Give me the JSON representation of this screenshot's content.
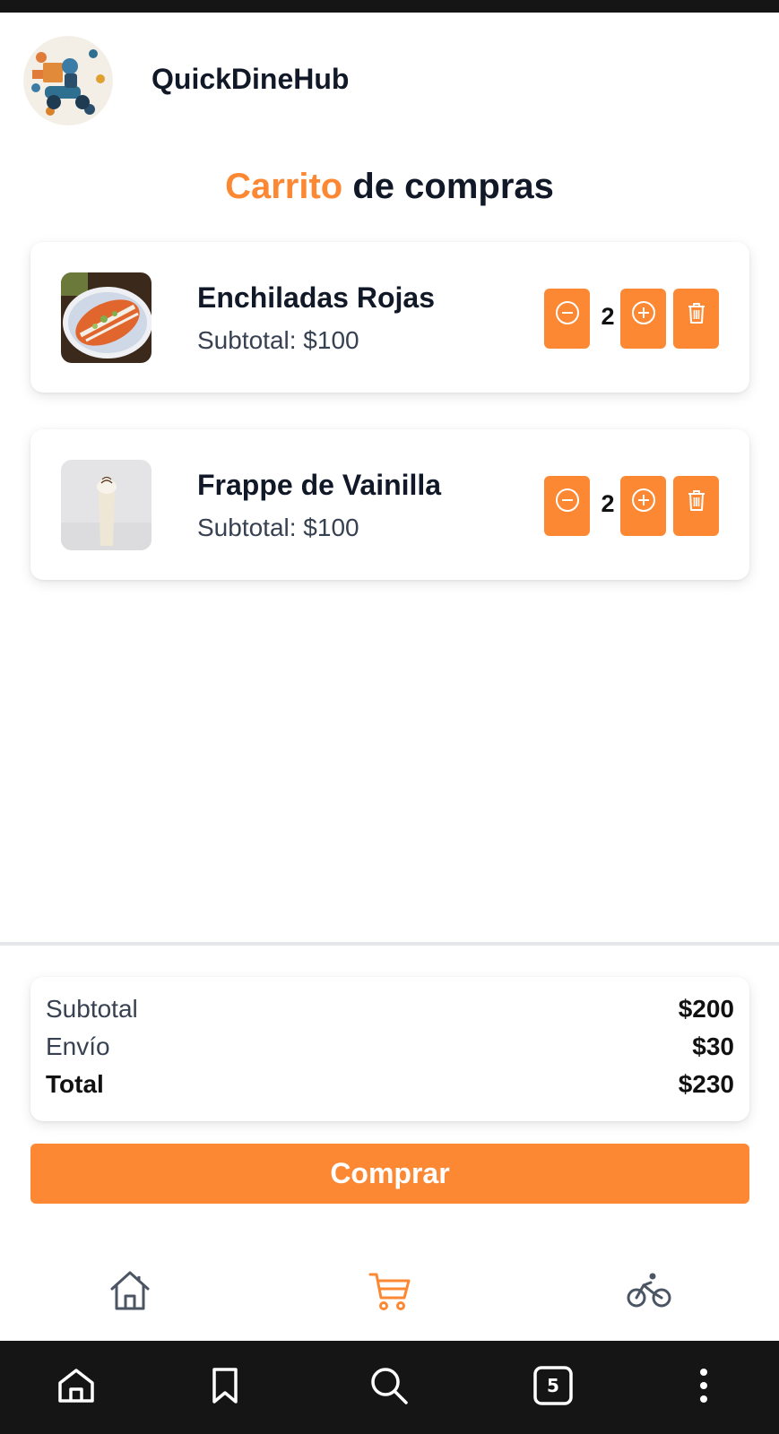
{
  "app": {
    "brand": "QuickDineHub"
  },
  "page": {
    "title_accent": "Carrito",
    "title_rest": "de compras"
  },
  "cart": {
    "items": [
      {
        "name": "Enchiladas Rojas",
        "subtotal": "Subtotal: $100",
        "quantity": "2"
      },
      {
        "name": "Frappe de Vainilla",
        "subtotal": "Subtotal: $100",
        "quantity": "2"
      }
    ]
  },
  "summary": {
    "subtotal_label": "Subtotal",
    "subtotal_value": "$200",
    "shipping_label": "Envío",
    "shipping_value": "$30",
    "total_label": "Total",
    "total_value": "$230"
  },
  "actions": {
    "buy_label": "Comprar"
  },
  "nav": {
    "items": [
      {
        "icon": "home-icon",
        "active": false
      },
      {
        "icon": "cart-icon",
        "active": true
      },
      {
        "icon": "bicycle-icon",
        "active": false
      }
    ]
  },
  "browser": {
    "tabs_count": "5"
  },
  "colors": {
    "accent": "#fd8834",
    "text": "#111827",
    "muted": "#374151",
    "browser_bar": "#151515"
  }
}
